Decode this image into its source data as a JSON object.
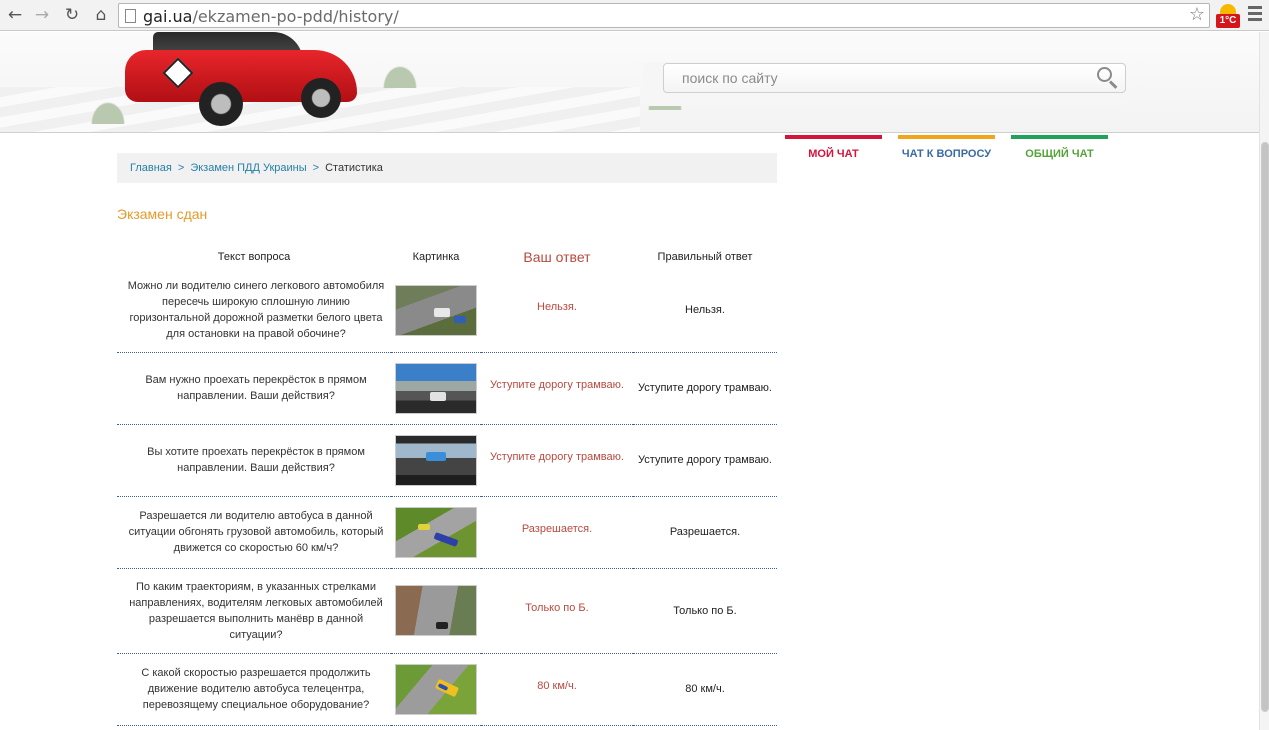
{
  "browser": {
    "url_host": "gai.ua",
    "url_path": "/ekzamen-po-pdd/history/",
    "extension_badge": "1°С"
  },
  "search": {
    "placeholder": "поиск по сайту"
  },
  "chat_tabs": [
    {
      "label": "МОЙ ЧАТ",
      "color": "#d5133b"
    },
    {
      "label": "ЧАТ К ВОПРОСУ",
      "color": "#f1a51c"
    },
    {
      "label": "ОБЩИЙ ЧАТ",
      "color": "#1fa35a"
    }
  ],
  "breadcrumb": {
    "home": "Главная",
    "separator": ">",
    "section": "Экзамен ПДД Украины",
    "current": "Статистика"
  },
  "exam_status": "Экзамен сдан",
  "table": {
    "headers": {
      "question": "Текст вопроса",
      "picture": "Картинка",
      "your_answer": "Ваш ответ",
      "correct_answer": "Правильный ответ"
    },
    "rows": [
      {
        "question": "Можно ли водителю синего легкового автомобиля пересечь широкую сплошную линию горизонтальной дорожной разметки белого цвета для остановки на правой обочине?",
        "your_answer": "Нельзя.",
        "correct_answer": "Нельзя.",
        "thumb": "road"
      },
      {
        "question": "Вам нужно проехать перекрёсток в прямом направлении. Ваши действия?",
        "your_answer": "Уступите дорогу трамваю.",
        "correct_answer": "Уступите дорогу трамваю.",
        "thumb": "city"
      },
      {
        "question": "Вы хотите проехать перекрёсток в прямом направлении. Ваши действия?",
        "your_answer": "Уступите дорогу трамваю.",
        "correct_answer": "Уступите дорогу трамваю.",
        "thumb": "cabin"
      },
      {
        "question": "Разрешается ли водителю автобуса в данной ситуации обгонять грузовой автомобиль, который движется со скоростью 60 км/ч?",
        "your_answer": "Разрешается.",
        "correct_answer": "Разрешается.",
        "thumb": "bus"
      },
      {
        "question": "По каким траекториям, в указанных стрелками направлениях, водителям легковых автомобилей разрешается выполнить манёвр в данной ситуации?",
        "your_answer": "Только по Б.",
        "correct_answer": "Только по Б.",
        "thumb": "town"
      },
      {
        "question": "С какой скоростью разрешается продолжить движение водителю автобуса телецентра, перевозящему специальное оборудование?",
        "your_answer": "80 км/ч.",
        "correct_answer": "80 км/ч.",
        "thumb": "tele"
      }
    ]
  }
}
